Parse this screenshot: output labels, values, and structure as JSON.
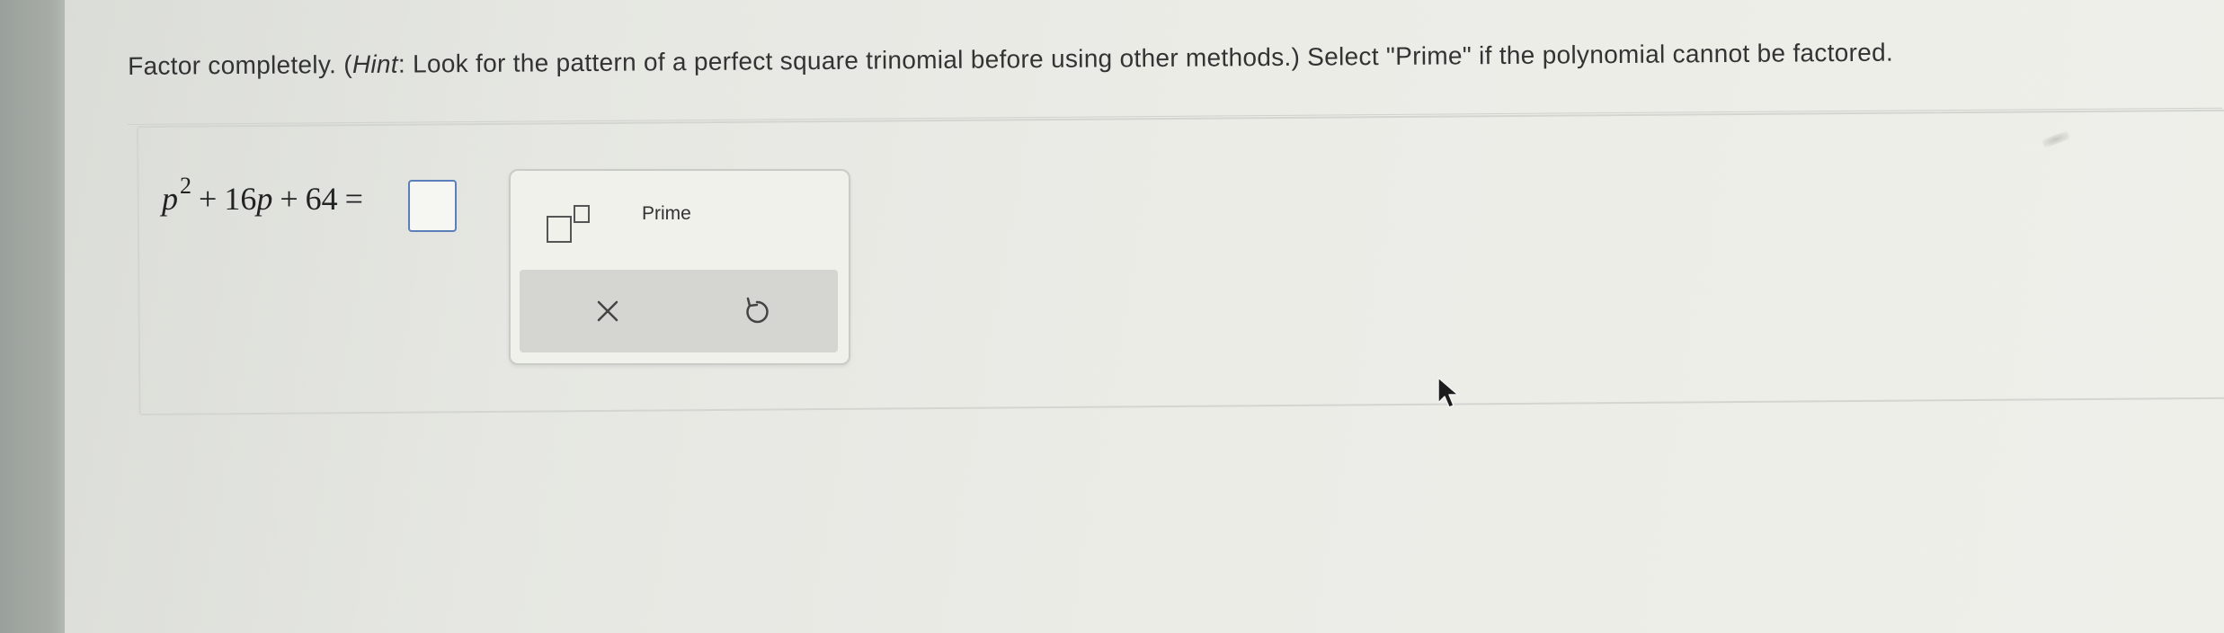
{
  "question": {
    "prefix": "Factor completely. (",
    "hint_label": "Hint",
    "hint_text": ": Look for the pattern of a perfect square trinomial before using other methods.) Select \"Prime\" if the polynomial cannot be factored."
  },
  "equation": {
    "variable": "p",
    "exponent": "2",
    "plus1": "+",
    "term2": "16",
    "plus2": "+",
    "term3": "64",
    "equals": "="
  },
  "palette": {
    "exponent_icon": "exponent-template-icon",
    "prime_label": "Prime",
    "clear_icon": "close-icon",
    "undo_icon": "undo-icon"
  },
  "colors": {
    "answer_box_border": "#5b7fb8",
    "action_bar": "#d5d6d1"
  }
}
